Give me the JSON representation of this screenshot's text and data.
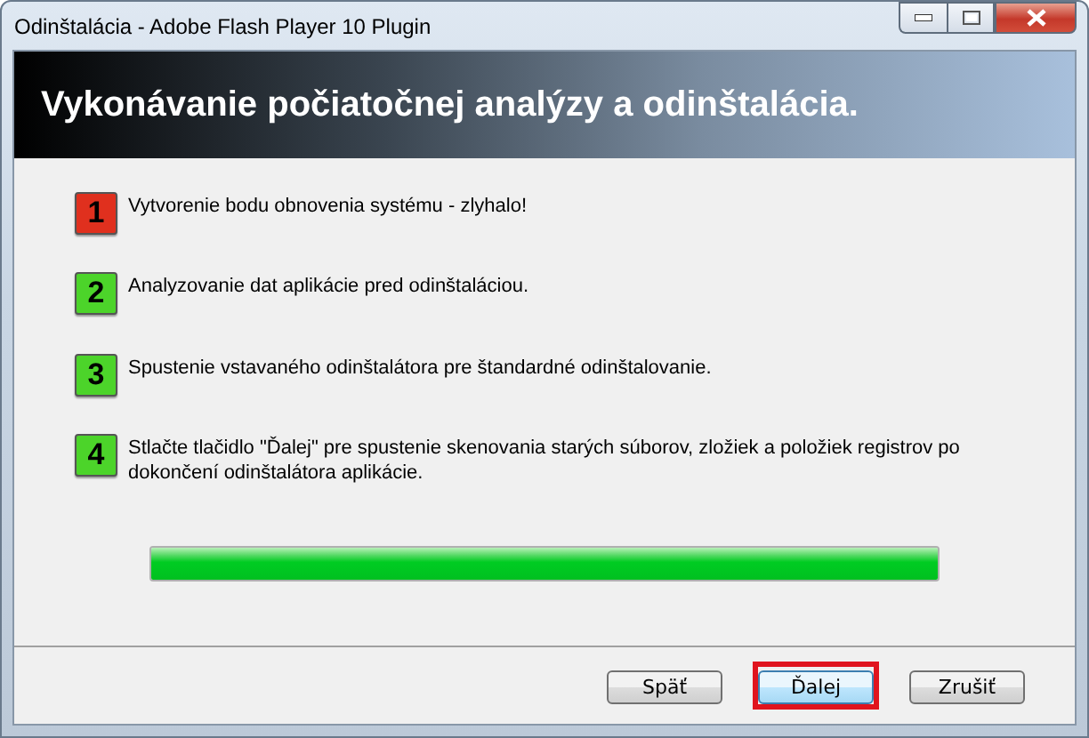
{
  "window": {
    "title": "Odinštalácia - Adobe Flash Player 10 Plugin"
  },
  "header": {
    "title": "Vykonávanie počiatočnej analýzy a odinštalácia."
  },
  "steps": [
    {
      "number": "1",
      "color": "#e0301e",
      "text": "Vytvorenie bodu obnovenia systému - zlyhalo!"
    },
    {
      "number": "2",
      "color": "#4cd42a",
      "text": "Analyzovanie dat aplikácie pred odinštaláciou."
    },
    {
      "number": "3",
      "color": "#4cd42a",
      "text": "Spustenie vstavaného odinštalátora pre štandardné odinštalovanie."
    },
    {
      "number": "4",
      "color": "#4cd42a",
      "text": "Stlačte tlačidlo \"Ďalej\" pre spustenie skenovania starých súborov, zložiek a položiek registrov po dokončení odinštalátora aplikácie."
    }
  ],
  "progress": {
    "level": 1
  },
  "buttons": [
    {
      "label": "Späť",
      "default": false,
      "highlighted": false
    },
    {
      "label": "Ďalej",
      "default": true,
      "highlighted": true
    },
    {
      "label": "Zrušiť",
      "default": false,
      "highlighted": false
    }
  ]
}
